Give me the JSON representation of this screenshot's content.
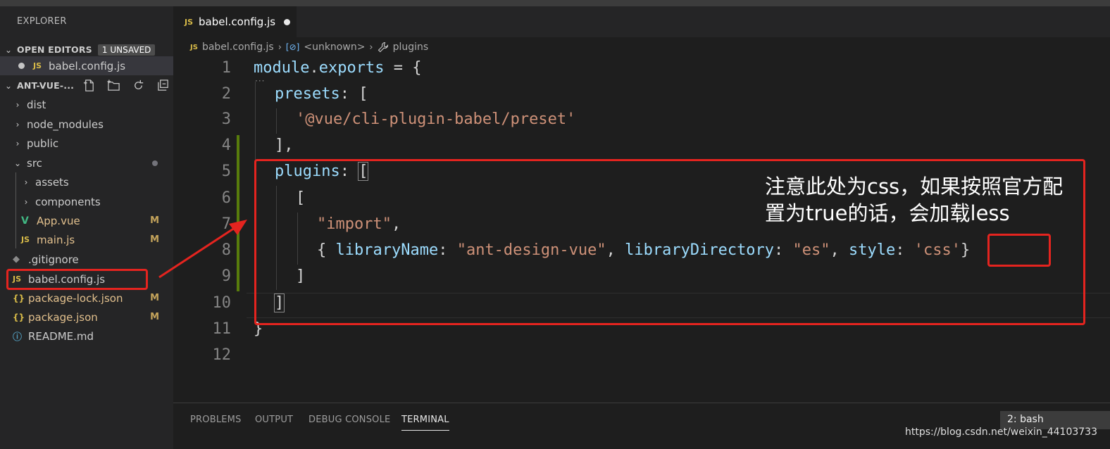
{
  "explorer": {
    "title": "EXPLORER",
    "open_editors": {
      "label": "OPEN EDITORS",
      "badge": "1 UNSAVED",
      "items": [
        {
          "icon": "JS",
          "name": "babel.config.js"
        }
      ]
    },
    "project": {
      "label": "ANT-VUE-...",
      "items": [
        {
          "type": "folder",
          "name": "dist"
        },
        {
          "type": "folder",
          "name": "node_modules"
        },
        {
          "type": "folder",
          "name": "public"
        },
        {
          "type": "folder",
          "name": "src",
          "expanded": true
        },
        {
          "type": "folder",
          "name": "assets"
        },
        {
          "type": "folder",
          "name": "components"
        },
        {
          "type": "file",
          "icon": "V",
          "name": "App.vue",
          "status": "M"
        },
        {
          "type": "file",
          "icon": "JS",
          "name": "main.js",
          "status": "M"
        },
        {
          "type": "file",
          "icon": "◆",
          "name": ".gitignore"
        },
        {
          "type": "file",
          "icon": "JS",
          "name": "babel.config.js"
        },
        {
          "type": "file",
          "icon": "{}",
          "name": "package-lock.json",
          "status": "M"
        },
        {
          "type": "file",
          "icon": "{}",
          "name": "package.json",
          "status": "M"
        },
        {
          "type": "file",
          "icon": "ⓘ",
          "name": "README.md"
        }
      ]
    }
  },
  "editor": {
    "tab": {
      "icon": "JS",
      "name": "babel.config.js"
    },
    "breadcrumb": {
      "icon": "JS",
      "file": "babel.config.js",
      "symbol_icon": "[⊘]",
      "symbol": "<unknown>",
      "leaf": "plugins"
    },
    "line_numbers": [
      "1",
      "2",
      "3",
      "4",
      "5",
      "6",
      "7",
      "8",
      "9",
      "10",
      "11",
      "12"
    ],
    "code": {
      "l1_a": "module",
      "l1_b": ".",
      "l1_c": "exports",
      "l1_d": " = {",
      "l2_a": "presets",
      "l2_b": ": [",
      "l3_a": "'@vue/cli-plugin-babel/preset'",
      "l4_a": "],",
      "l5_a": "plugins",
      "l5_b": ": ",
      "l5_c": "[",
      "l6_a": "[",
      "l7_a": "\"import\"",
      "l7_b": ",",
      "l8_a": "{ ",
      "l8_b": "libraryName",
      "l8_c": ": ",
      "l8_d": "\"ant-design-vue\"",
      "l8_e": ", ",
      "l8_f": "libraryDirectory",
      "l8_g": ": ",
      "l8_h": "\"es\"",
      "l8_i": ", ",
      "l8_j": "style",
      "l8_k": ": ",
      "l8_l": "'css'",
      "l8_m": "}",
      "l9_a": "]",
      "l10_a": "]",
      "l11_a": "}"
    }
  },
  "annotation": {
    "line1": "注意此处为css，如果按照官方配",
    "line2": "置为true的话，会加载less"
  },
  "panel": {
    "tabs": [
      "PROBLEMS",
      "OUTPUT",
      "DEBUG CONSOLE",
      "TERMINAL"
    ],
    "terminal_select": "2: bash"
  },
  "watermark": "https://blog.csdn.net/weixin_44103733",
  "colors": {
    "accent_red": "#e4241f",
    "modified": "#c5a45b",
    "js_icon": "#d7ba48",
    "vue_icon": "#41b883"
  }
}
